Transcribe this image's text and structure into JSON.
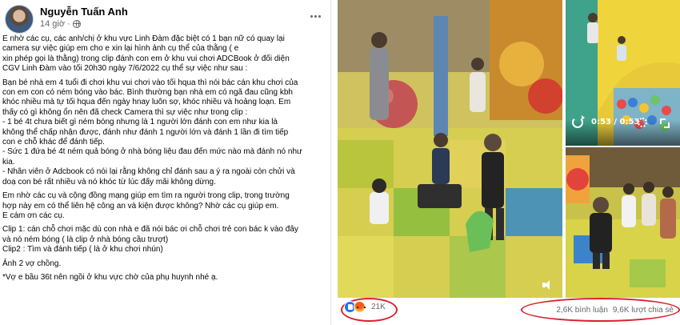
{
  "post": {
    "author": "Nguyễn Tuấn Anh",
    "time": "14 giờ",
    "paragraphs": [
      [
        "E nhờ các cụ, các anh/chị ở khu vực Linh Đàm đặc biệt có 1 bạn nữ có quay lại",
        "camera sự việc giúp em cho e xin lại hình ảnh cụ thể của thằng ( e",
        "xin phép gọi là thằng) trong clip đánh con em ở khu vui chơi ADCBook ở đối diện",
        "CGV Linh Đàm vào tối 20h30 ngày 7/6/2022 cụ thể sự việc như sau :"
      ],
      [
        "Bạn bé nhà em 4 tuổi đi chơi khu vui chơi vào tối hqua thì nói bác cán khu chơi của",
        "con em con có ném bóng vào bác. Bình thường bạn nhà em có ngã đau cũng kbh",
        "khóc nhiều mà tự tối hqua đến ngày hnay luôn sợ, khóc nhiều và hoảng loạn. Em",
        "thấy có gì không ổn nên đã check Camera thì sự việc như trong clip :",
        "- 1 bé 4t chưa biết gì ném bóng nhưng là 1 người lớn đánh con em như kia là",
        "không thể chấp nhận được, đánh như đánh 1 người lớn và đánh 1 lần đi tìm tiếp",
        "con e chỗ khác để đánh tiếp.",
        "- Sức 1 đứa bé 4t ném quả bóng ở nhà bóng liệu đau đến mức nào mà đánh nó như",
        "kia.",
        "- Nhân viên ở Adcbook có nói lại rằng không chỉ đánh sau a ý ra ngoài còn chửi và",
        "doạ con bé rất nhiều và nó khóc từ lúc đấy mãi không dừng."
      ],
      [
        "Em nhờ các cụ và cộng đồng mạng giúp em tìm ra người trong clip, trong trường",
        "hợp này em có thể liên hệ công an và kiện được không? Nhờ các cụ giúp em.",
        "E cám ơn các cụ."
      ],
      [
        "Clip 1: cán chỗ chơi mặc dù con nhà e đã nói bác ơi chỗ chơi trẻ con bác k vào đây",
        "và nó ném bóng ( là clip ở nhà bóng cầu trượt)",
        "Clip2 : Tìm và đánh tiếp ( là ở khu chơi nhún)"
      ],
      [
        "Ảnh  2 vợ chồng."
      ],
      [
        "*Vợ e bầu 36t nên ngồi ở khu vực chờ của phụ huynh nhé ạ."
      ]
    ]
  },
  "video": {
    "time_label": "0:53 / 0:53",
    "icons": [
      "replay-icon",
      "gear-icon",
      "expand-icon",
      "mute-icon"
    ]
  },
  "engagement": {
    "reaction_count": "21K",
    "comments": "2,6K bình luận",
    "shares": "9,6K lượt chia sẻ",
    "highlight_color": "#d9232e"
  }
}
